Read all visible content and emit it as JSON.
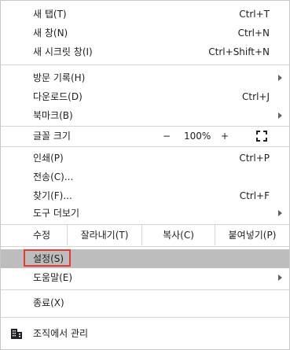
{
  "menu": {
    "new_tab": {
      "label": "새 탭(T)",
      "shortcut": "Ctrl+T"
    },
    "new_window": {
      "label": "새 창(N)",
      "shortcut": "Ctrl+N"
    },
    "new_incognito": {
      "label": "새 시크릿 창(I)",
      "shortcut": "Ctrl+Shift+N"
    },
    "history": {
      "label": "방문 기록(H)"
    },
    "downloads": {
      "label": "다운로드(D)",
      "shortcut": "Ctrl+J"
    },
    "bookmarks": {
      "label": "북마크(B)"
    },
    "zoom": {
      "label": "글꼴 크기",
      "minus": "−",
      "value": "100%",
      "plus": "+"
    },
    "print": {
      "label": "인쇄(P)",
      "shortcut": "Ctrl+P"
    },
    "cast": {
      "label": "전송(C)..."
    },
    "find": {
      "label": "찾기(F)...",
      "shortcut": "Ctrl+F"
    },
    "more_tools": {
      "label": "도구 더보기"
    },
    "edit": {
      "label": "수정",
      "cut": "잘라내기(T)",
      "copy": "복사(C)",
      "paste": "붙여넣기(P)"
    },
    "settings": {
      "label": "설정(S)"
    },
    "help": {
      "label": "도움말(E)"
    },
    "exit": {
      "label": "종료(X)"
    },
    "managed": {
      "label": "조직에서 관리"
    }
  },
  "colors": {
    "highlight": "#bdbdbd",
    "outline": "#e53935",
    "separator": "#d4d4d4"
  },
  "icons": {
    "submenu": "chevron-right-icon",
    "fullscreen": "fullscreen-icon",
    "managed": "building-icon"
  }
}
